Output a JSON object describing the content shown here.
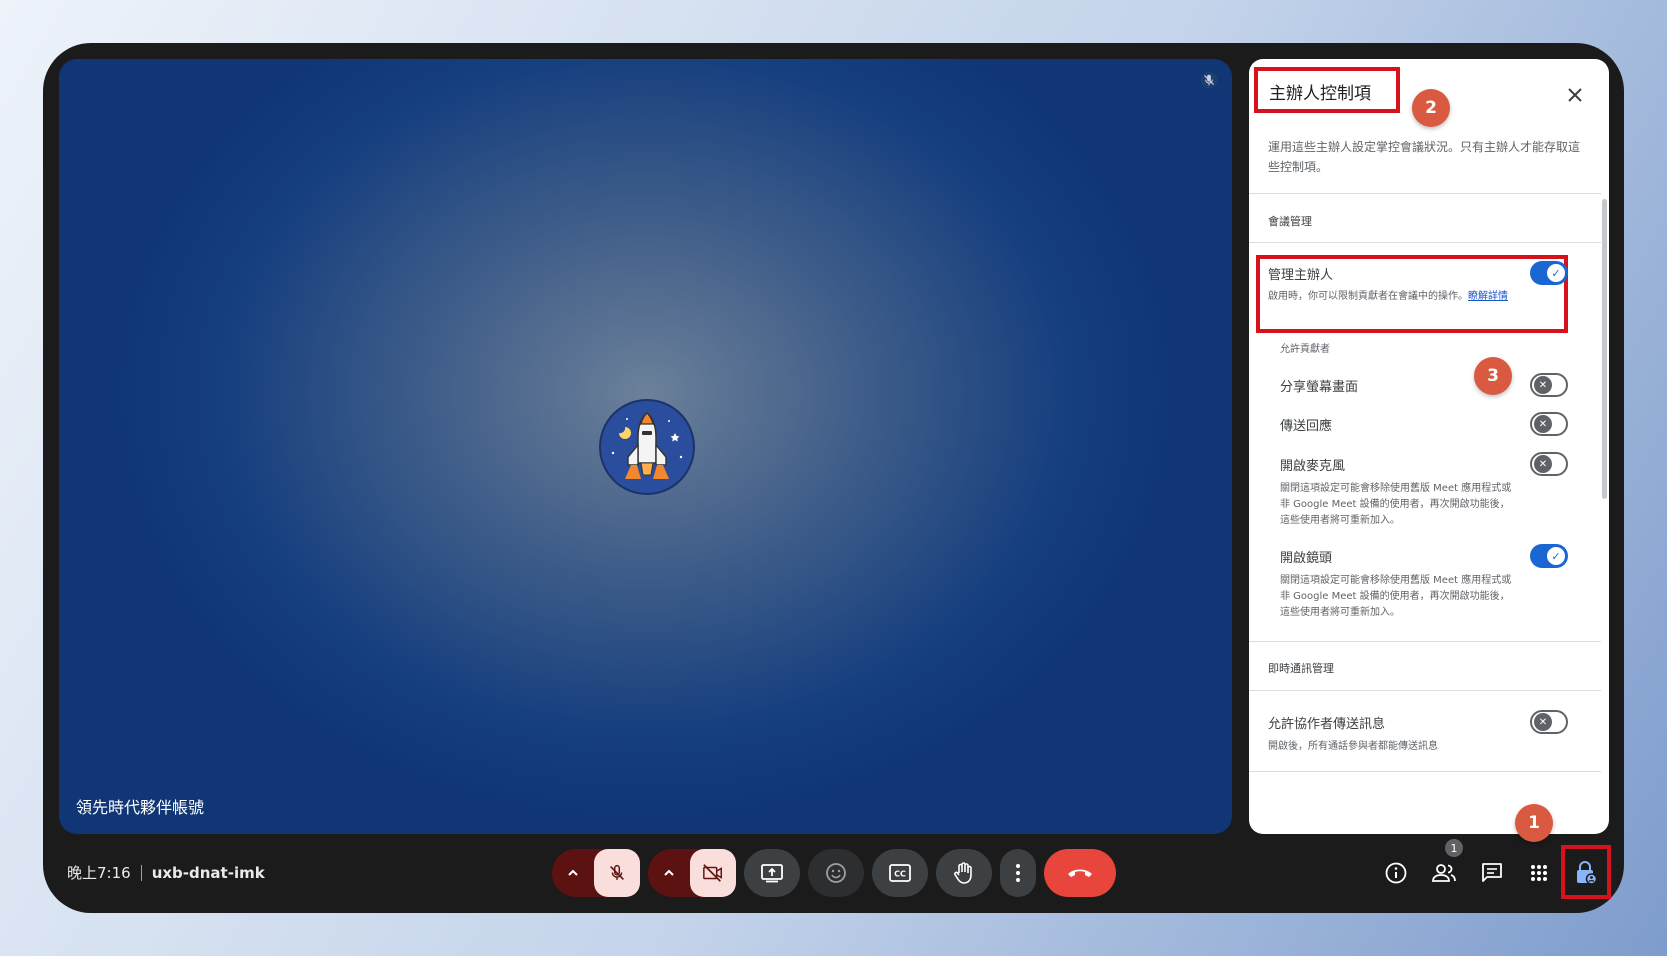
{
  "tile": {
    "participant_name": "領先時代夥伴帳號",
    "mic_status_icon": "mic-off-icon",
    "avatar_icon": "space-shuttle-avatar-icon"
  },
  "panel": {
    "title": "主辦人控制項",
    "description": "運用這些主辦人設定掌控會議狀況。只有主辦人才能存取這些控制項。",
    "section_meeting": "會議管理",
    "manage_hosts": {
      "label": "管理主辦人",
      "desc": "啟用時，你可以限制貢獻者在會議中的操作。",
      "link": "瞭解詳情",
      "on": true
    },
    "allow_contributors": "允許貢獻者",
    "settings": [
      {
        "label": "分享螢幕畫面",
        "on": false
      },
      {
        "label": "傳送回應",
        "on": false
      },
      {
        "label": "開啟麥克風",
        "on": false,
        "desc": "關閉這項設定可能會移除使用舊版 Meet 應用程式或非 Google Meet 設備的使用者，再次開啟功能後，這些使用者將可重新加入。"
      },
      {
        "label": "開啟鏡頭",
        "on": true,
        "desc": "關閉這項設定可能會移除使用舊版 Meet 應用程式或非 Google Meet 設備的使用者，再次開啟功能後，這些使用者將可重新加入。"
      }
    ],
    "section_chat": "即時通訊管理",
    "allow_chat": {
      "label": "允許協作者傳送訊息",
      "desc": "開啟後，所有通話參與者都能傳送訊息",
      "on": false
    }
  },
  "annotations": {
    "badge1": "1",
    "badge2": "2",
    "badge3": "3"
  },
  "bottom_bar": {
    "time": "晚上7:16",
    "meeting_code": "uxb-dnat-imk",
    "people_count": "1"
  },
  "colors": {
    "accent": "#1a66d2",
    "highlight_box": "#d6131c",
    "badge": "#d95a40",
    "end_call": "#e8453c",
    "muted_btn": "#f9dedc"
  }
}
